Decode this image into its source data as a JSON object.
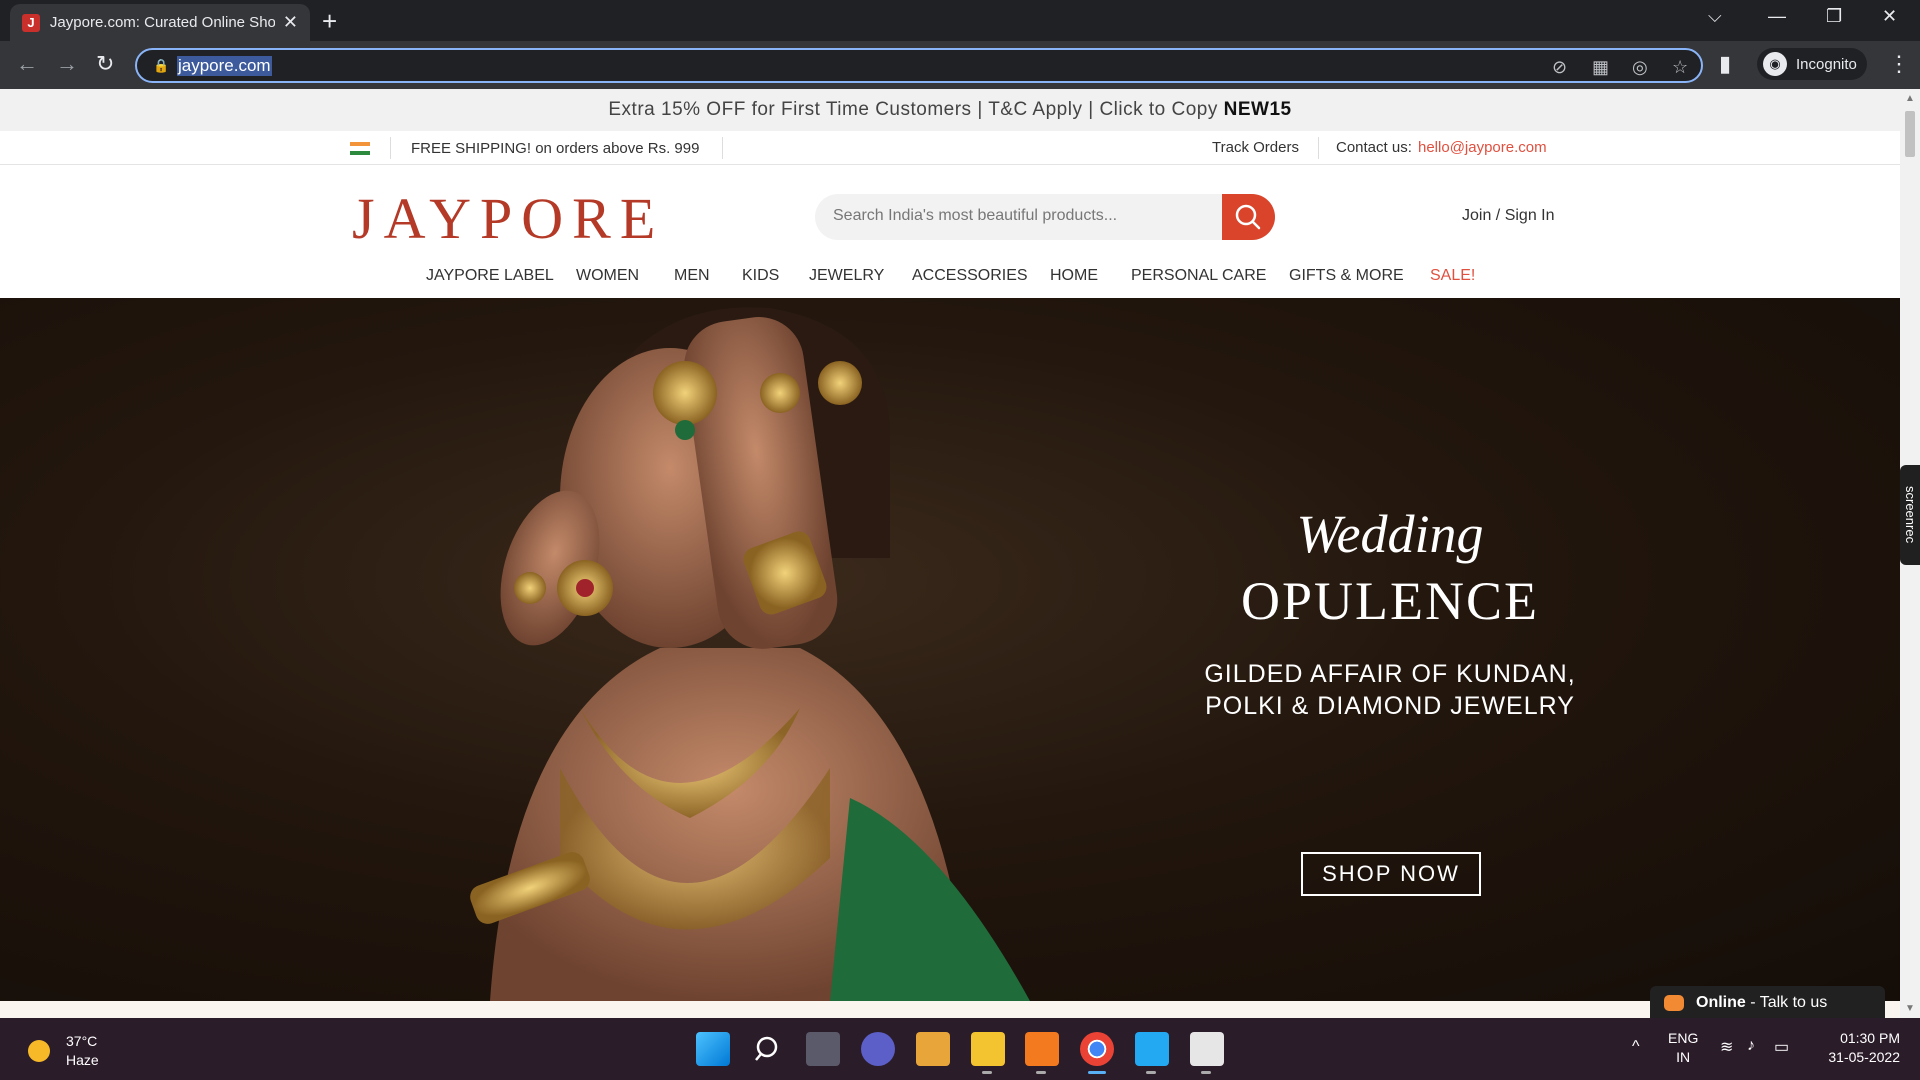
{
  "browser": {
    "tab_title": "Jaypore.com: Curated Online Sho",
    "favicon_letter": "J",
    "url": "jaypore.com",
    "profile_label": "Incognito"
  },
  "promo": {
    "text": "Extra 15% OFF for First Time Customers | T&C Apply | Click to Copy",
    "code": "NEW15"
  },
  "infobar": {
    "shipping": "FREE SHIPPING! on orders above Rs. 999",
    "track_orders": "Track Orders",
    "contact_label": "Contact us:",
    "contact_email": "hello@jaypore.com"
  },
  "header": {
    "logo": "JAYPORE",
    "search_placeholder": "Search India's most beautiful products...",
    "signin": "Join / Sign In"
  },
  "nav": {
    "items": [
      "JAYPORE LABEL",
      "WOMEN",
      "MEN",
      "KIDS",
      "JEWELRY",
      "ACCESSORIES",
      "HOME",
      "PERSONAL CARE",
      "GIFTS & MORE",
      "SALE!"
    ],
    "sale_color": "#e0503f"
  },
  "hero": {
    "line1": "Wedding",
    "line2": "OPULENCE",
    "sub1": "GILDED AFFAIR OF KUNDAN,",
    "sub2": "POLKI & DIAMOND JEWELRY",
    "cta": "SHOP NOW"
  },
  "chat": {
    "status": "Online",
    "text": " - Talk to us"
  },
  "screenrec_label": "screenrec",
  "taskbar": {
    "temperature": "37°C",
    "weather": "Haze",
    "lang1": "ENG",
    "lang2": "IN",
    "time": "01:30 PM",
    "date": "31-05-2022"
  },
  "colors": {
    "brand": "#b43a27",
    "search_button": "#d9442b",
    "omnibox_focus": "#8ab4f8"
  }
}
